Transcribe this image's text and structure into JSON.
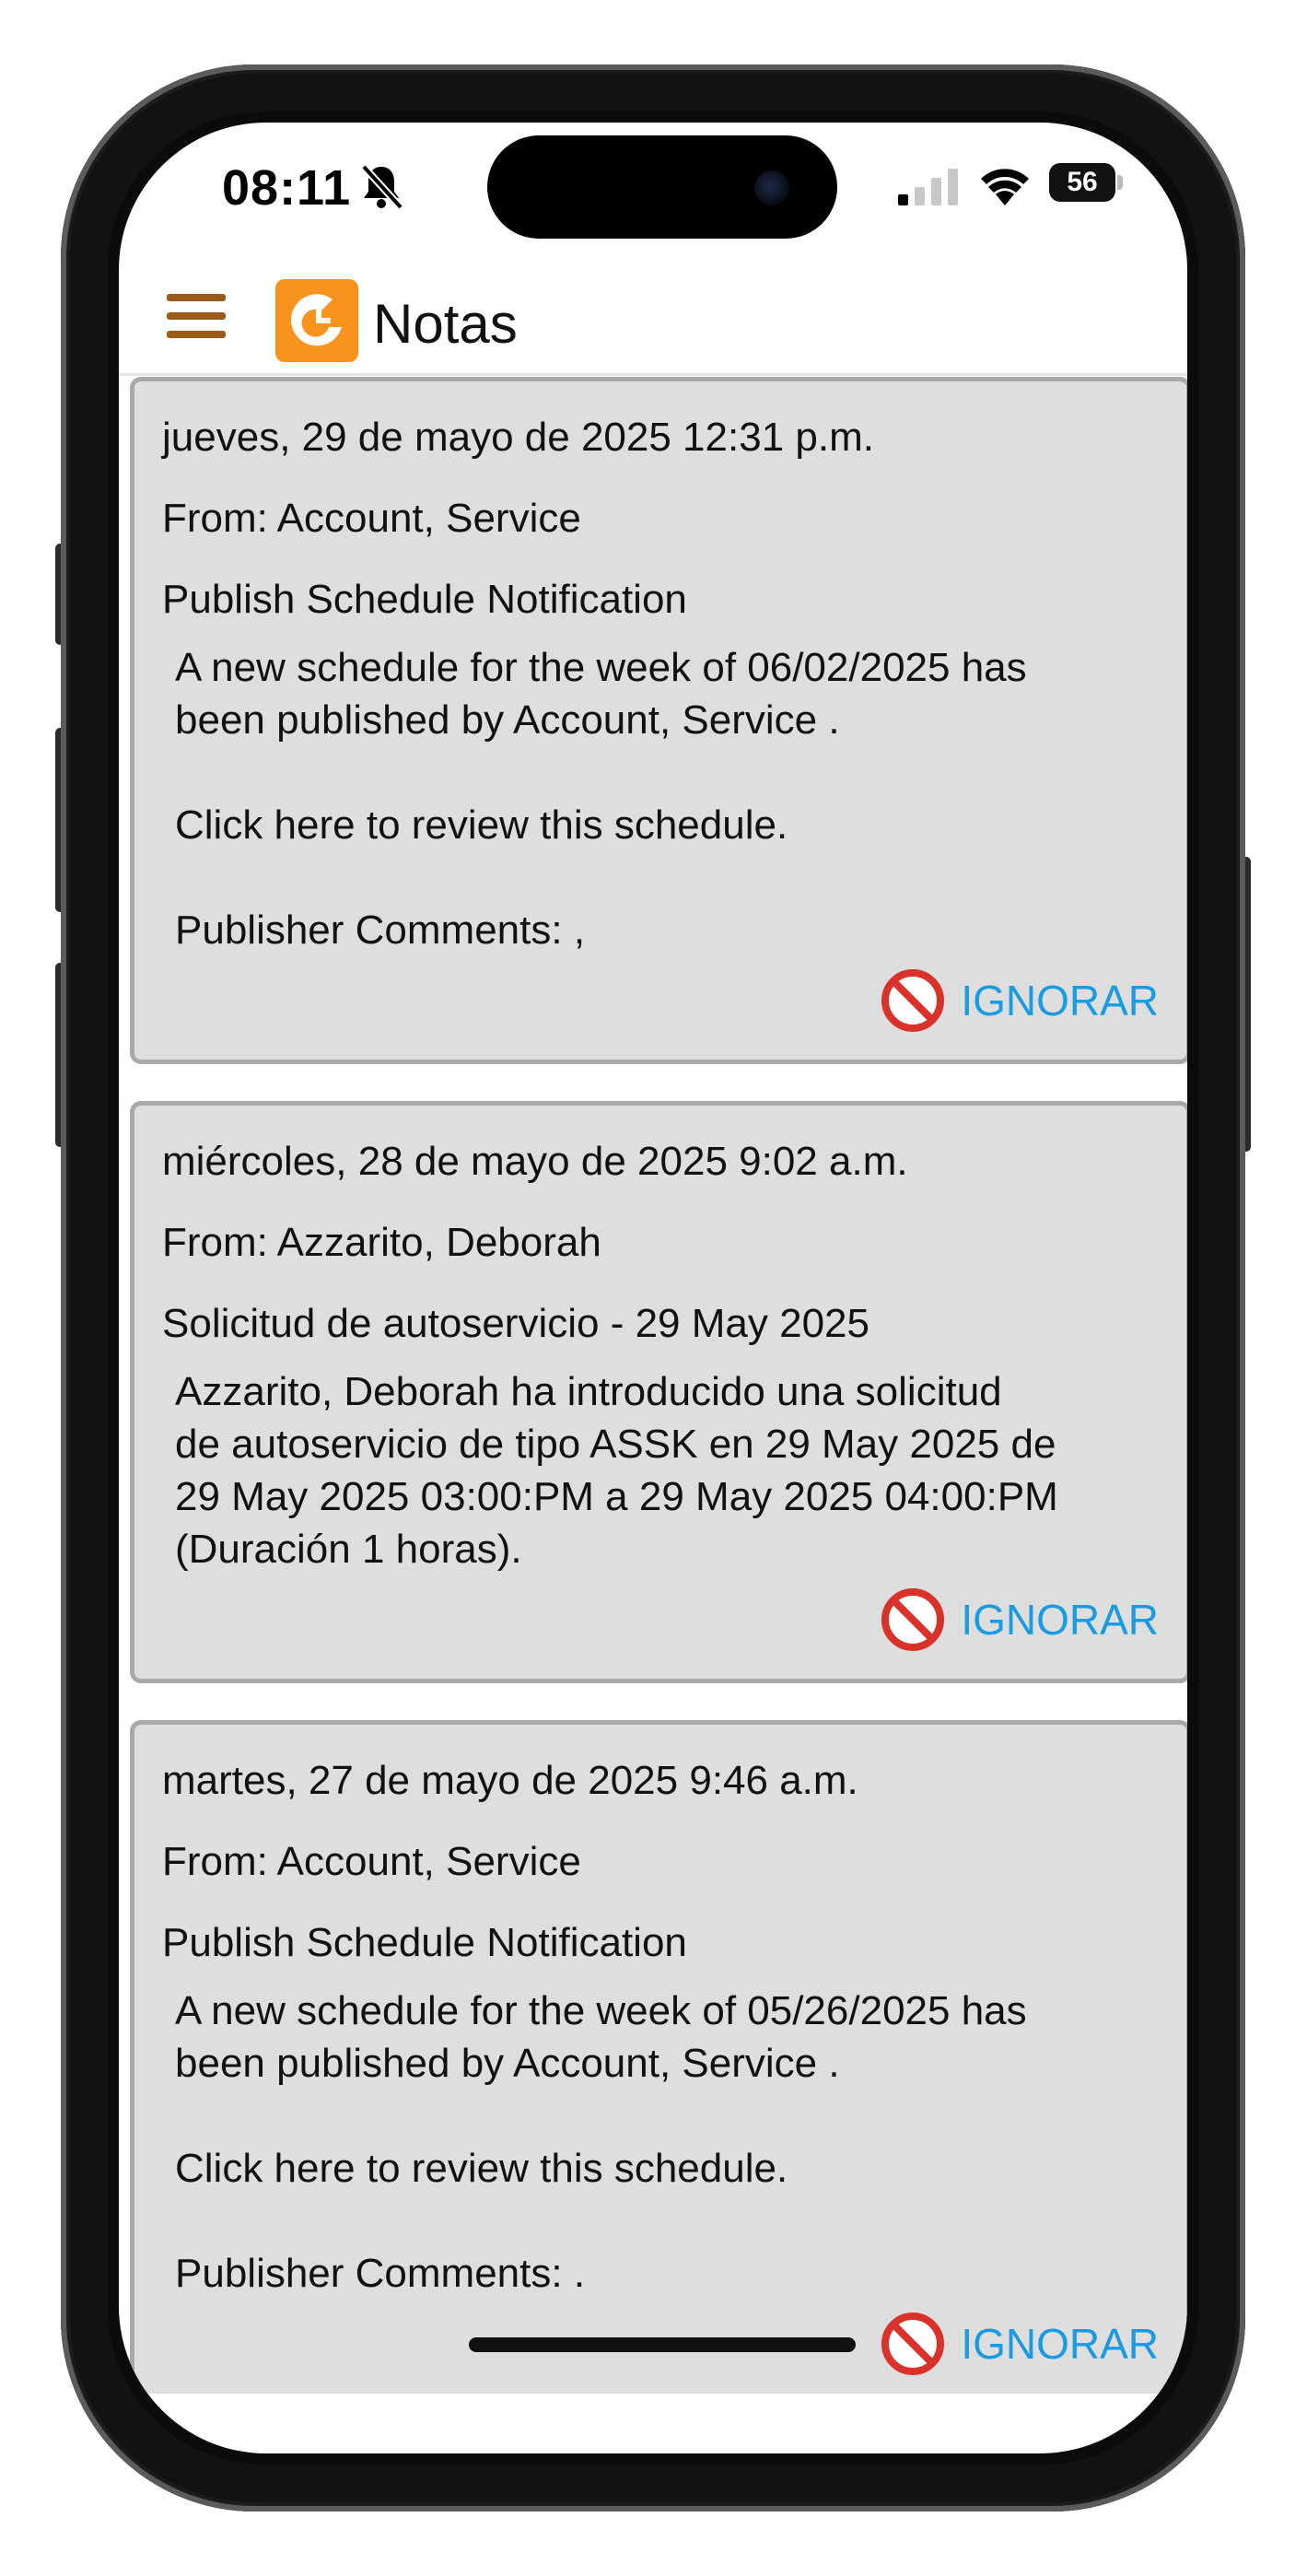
{
  "status_bar": {
    "time": "08:11",
    "battery": "56"
  },
  "header": {
    "title": "Notas"
  },
  "notes": [
    {
      "date": "jueves, 29 de mayo de 2025 12:31 p.m.",
      "from": "From: Account, Service",
      "subject": "Publish Schedule Notification",
      "body": "A new schedule for the week of 06/02/2025 has\nbeen published by Account, Service .\n\nClick here to review this schedule.\n\nPublisher Comments: ,",
      "action": "IGNORAR"
    },
    {
      "date": "miércoles, 28 de mayo de 2025 9:02 a.m.",
      "from": "From: Azzarito, Deborah",
      "subject": "Solicitud de autoservicio - 29 May 2025",
      "body": "Azzarito, Deborah  ha introducido una solicitud\nde autoservicio de tipo ASSK en 29 May 2025 de\n29 May 2025 03:00:PM a 29 May 2025 04:00:PM\n(Duración 1 horas).",
      "action": "IGNORAR"
    },
    {
      "date": "martes, 27 de mayo de 2025 9:46 a.m.",
      "from": "From: Account, Service",
      "subject": "Publish Schedule Notification",
      "body": "A new schedule for the week of 05/26/2025 has\nbeen published by Account, Service .\n\nClick here to review this schedule.\n\nPublisher Comments: .",
      "action": "IGNORAR"
    }
  ],
  "colors": {
    "accent": "#1a9be0",
    "menu": "#9c5a1a",
    "logo": "#f7931e",
    "card_bg": "#dedede",
    "ban": "#d9322b"
  }
}
